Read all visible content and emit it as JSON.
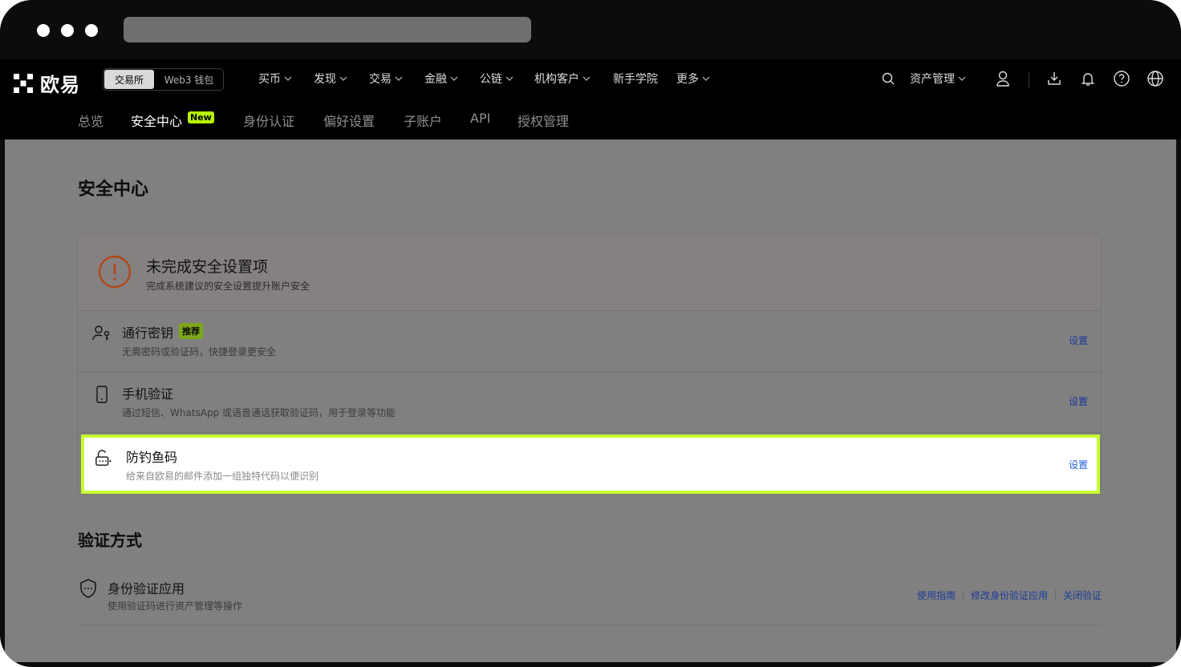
{
  "brand": {
    "name": "欧易"
  },
  "mode_toggle": {
    "exchange": "交易所",
    "web3": "Web3 钱包"
  },
  "top_nav": {
    "items": [
      "买币",
      "发现",
      "交易",
      "金融",
      "公链",
      "机构客户",
      "新手学院",
      "更多"
    ],
    "asset_management": "资产管理"
  },
  "sub_nav": {
    "items": [
      "总览",
      "安全中心",
      "身份认证",
      "偏好设置",
      "子账户",
      "API",
      "授权管理"
    ],
    "new_badge": "New"
  },
  "page": {
    "title": "安全中心"
  },
  "security_card": {
    "heading": "未完成安全设置项",
    "subheading": "完成系统建议的安全设置提升账户安全",
    "rows": [
      {
        "title": "通行密钥",
        "badge": "推荐",
        "desc": "无需密码或验证码，快捷登录更安全",
        "action": "设置"
      },
      {
        "title": "手机验证",
        "desc": "通过短信、WhatsApp 或语音通话获取验证码，用于登录等功能",
        "action": "设置"
      },
      {
        "title": "防钓鱼码",
        "desc": "给来自欧易的邮件添加一组独特代码以便识别",
        "action": "设置"
      }
    ]
  },
  "verification": {
    "title": "验证方式",
    "rows": [
      {
        "title": "身份验证应用",
        "desc": "使用验证码进行资产管理等操作",
        "actions": [
          "使用指南",
          "修改身份验证应用",
          "关闭验证"
        ]
      }
    ]
  },
  "colors": {
    "highlight_border": "#c6ff2e",
    "new_badge": "#b7f500",
    "link": "#1f5fe0",
    "warning": "#c2410c"
  }
}
